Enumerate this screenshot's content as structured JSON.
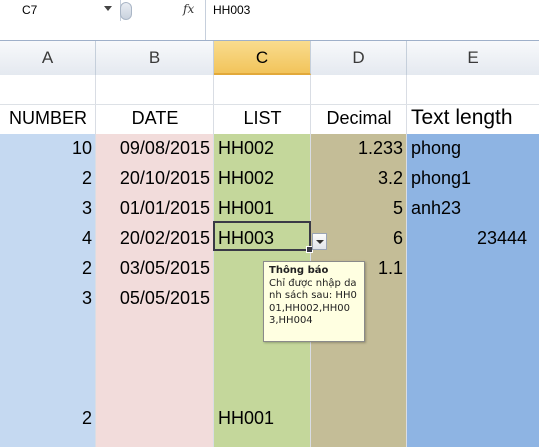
{
  "formula_bar": {
    "name_box": "C7",
    "fx_label": "fx",
    "value": "HH003"
  },
  "columns": [
    "A",
    "B",
    "C",
    "D",
    "E"
  ],
  "selected_column": "C",
  "colors": {
    "col_a": "#c5d9f1",
    "col_b": "#f2dcdb",
    "col_c": "#c4d79b",
    "col_d": "#c4bd97",
    "col_e": "#8eb4e3",
    "header_selected": "#f6cd6c"
  },
  "headers": {
    "a": "NUMBER",
    "b": "DATE",
    "c": "LIST",
    "d": "Decimal",
    "e": "Text length"
  },
  "rows": [
    {
      "a": "10",
      "b": "09/08/2015",
      "c": "HH002",
      "d": "1.233",
      "e": "phong"
    },
    {
      "a": "2",
      "b": "20/10/2015",
      "c": "HH002",
      "d": "3.2",
      "e": "phong1"
    },
    {
      "a": "3",
      "b": "01/01/2015",
      "c": "HH001",
      "d": "5",
      "e": "anh23"
    },
    {
      "a": "4",
      "b": "20/02/2015",
      "c": "HH003",
      "d": "6",
      "e": "23444"
    },
    {
      "a": "2",
      "b": "03/05/2015",
      "c": "",
      "d": "1.1",
      "e": ""
    },
    {
      "a": "3",
      "b": "05/05/2015",
      "c": "",
      "d": "",
      "e": ""
    },
    {
      "a": "",
      "b": "",
      "c": "",
      "d": "",
      "e": ""
    },
    {
      "a": "",
      "b": "",
      "c": "",
      "d": "",
      "e": ""
    },
    {
      "a": "2",
      "b": "",
      "c": "HH001",
      "d": "",
      "e": ""
    }
  ],
  "validation_tip": {
    "title": "Thông báo",
    "message": "Chỉ được nhập danh sách sau: HH001,HH002,HH003,HH004"
  }
}
